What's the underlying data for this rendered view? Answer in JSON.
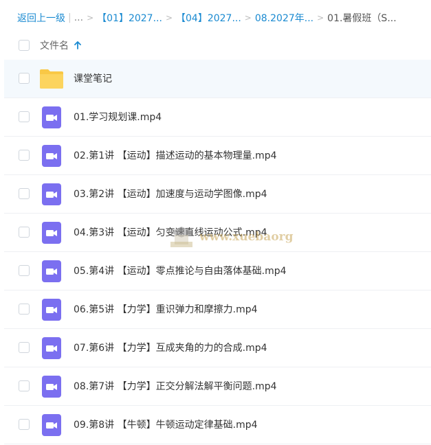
{
  "breadcrumb": {
    "back": "返回上一级",
    "ellipsis": "...",
    "items": [
      "【01】2027...",
      "【04】2027...",
      "08.2027年...",
      "01.暑假班（S..."
    ]
  },
  "header": {
    "column_name": "文件名"
  },
  "files": [
    {
      "name": "课堂笔记",
      "type": "folder"
    },
    {
      "name": "01.学习规划课.mp4",
      "type": "video"
    },
    {
      "name": "02.第1讲 【运动】描述运动的基本物理量.mp4",
      "type": "video"
    },
    {
      "name": "03.第2讲 【运动】加速度与运动学图像.mp4",
      "type": "video"
    },
    {
      "name": "04.第3讲 【运动】匀变速直线运动公式.mp4",
      "type": "video"
    },
    {
      "name": "05.第4讲 【运动】零点推论与自由落体基础.mp4",
      "type": "video"
    },
    {
      "name": "06.第5讲 【力学】重识弹力和摩擦力.mp4",
      "type": "video"
    },
    {
      "name": "07.第6讲 【力学】互成夹角的力的合成.mp4",
      "type": "video"
    },
    {
      "name": "08.第7讲 【力学】正交分解法解平衡问题.mp4",
      "type": "video"
    },
    {
      "name": "09.第8讲 【牛顿】牛顿运动定律基础.mp4",
      "type": "video"
    }
  ],
  "watermark": "www.xuebaorg",
  "colors": {
    "link": "#1a8ad1",
    "folder": "#f9c846",
    "video": "#7b6ff0"
  }
}
